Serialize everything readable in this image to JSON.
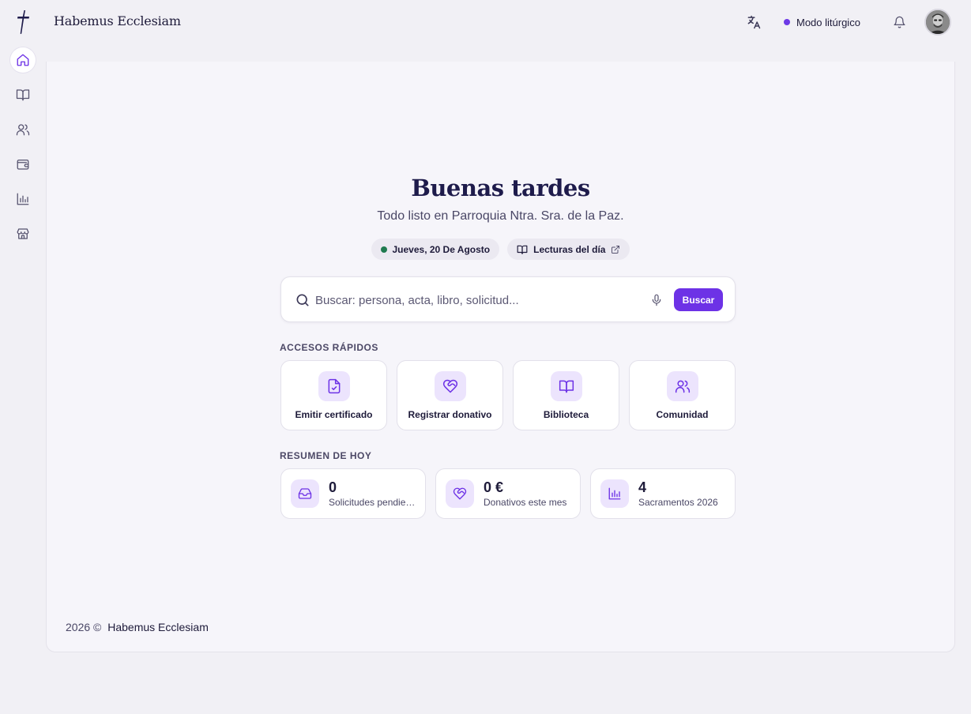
{
  "app": {
    "brand": "Habemus Ecclesiam"
  },
  "header": {
    "liturgical_mode": "Modo litúrgico",
    "accent_color": "#6d32e6"
  },
  "sidebar": {
    "items": [
      {
        "icon": "home-icon",
        "active": true
      },
      {
        "icon": "book-icon",
        "active": false
      },
      {
        "icon": "users-icon",
        "active": false
      },
      {
        "icon": "wallet-icon",
        "active": false
      },
      {
        "icon": "bar-chart-icon",
        "active": false
      },
      {
        "icon": "store-icon",
        "active": false
      }
    ]
  },
  "main": {
    "greeting": "Buenas tardes",
    "subtitle": "Todo listo en Parroquia Ntra. Sra. de la Paz.",
    "date_chip": "Jueves, 20 De Agosto",
    "readings_chip": "Lecturas del día",
    "search": {
      "placeholder": "Buscar: persona, acta, libro, solicitud...",
      "button": "Buscar"
    },
    "quick_access": {
      "title": "ACCESOS RÁPIDOS",
      "items": [
        {
          "label": "Emitir certificado",
          "icon": "file-check-icon"
        },
        {
          "label": "Registrar donativo",
          "icon": "heart-handshake-icon"
        },
        {
          "label": "Biblioteca",
          "icon": "book-open-icon"
        },
        {
          "label": "Comunidad",
          "icon": "users-icon"
        }
      ]
    },
    "summary": {
      "title": "RESUMEN DE HOY",
      "items": [
        {
          "value": "0",
          "label": "Solicitudes pendientes",
          "icon": "inbox-icon"
        },
        {
          "value": "0 €",
          "label": "Donativos este mes",
          "icon": "heart-handshake-icon"
        },
        {
          "value": "4",
          "label": "Sacramentos 2026",
          "icon": "bar-chart-icon"
        }
      ]
    }
  },
  "footer": {
    "year_copy": "2026 ©",
    "brand": "Habemus Ecclesiam"
  }
}
